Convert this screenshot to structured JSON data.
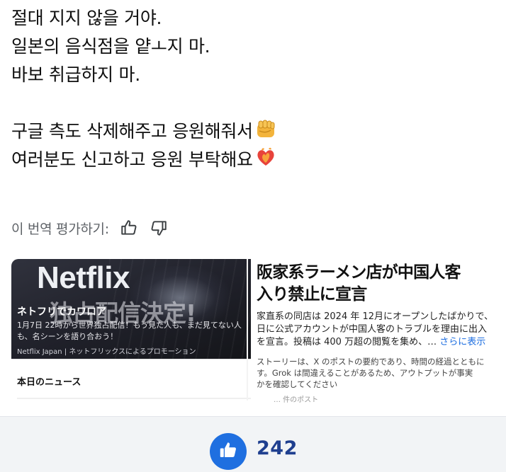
{
  "post": {
    "lines": [
      "절대 지지 않을 거야.",
      "일본의 음식점을 얕ㅗ지 마.",
      "바보 취급하지 마.",
      "구글 측도 삭제해주고 응원해줘서",
      "여러분도 신고하고 응원 부탁해요"
    ],
    "emojis": [
      "fist-emoji",
      "burning-heart-emoji"
    ]
  },
  "translation_rating": {
    "label": "이 번역 평가하기:",
    "up_icon": "thumbs-up-icon",
    "down_icon": "thumbs-down-icon"
  },
  "promo_card": {
    "logo_text": "Netflix",
    "headline": "独占配信決定!",
    "tagline": "ネトフリでカワロア",
    "description": "1月7日 22時から世界独占配信！もう見た人も、まだ見てない人も、名シーンを語り合おう！",
    "source": "Netflix Japan | ネットフリックスによるプロモーション"
  },
  "news_section": {
    "label": "本日のニュース"
  },
  "news_card": {
    "title_lines": [
      "阪家系ラーメン店が中国人客",
      "入り禁止に宣言"
    ],
    "summary_lines": [
      "家直系の同店は 2024 年 12月にオープンしたばかりで、",
      "日に公式アカウントが中国人客のトラブルを理由に出入",
      "を宣言。投稿は 400 万超の閲覧を集め、…"
    ],
    "more_label": "さらに表示",
    "note_lines": [
      "ストーリーは、X のポストの要約であり、時間の経過とともに",
      "す。Grok は間違えることがあるため、アウトプットが事実",
      "かを確認してください"
    ],
    "footer": "… 件のポスト"
  },
  "like_bar": {
    "icon": "thumbs-up-icon",
    "count": "242"
  },
  "colors": {
    "accent": "#1f6fe0",
    "count_text": "#1f3f8f",
    "link": "#1d6ee0",
    "muted": "#5f6368"
  }
}
